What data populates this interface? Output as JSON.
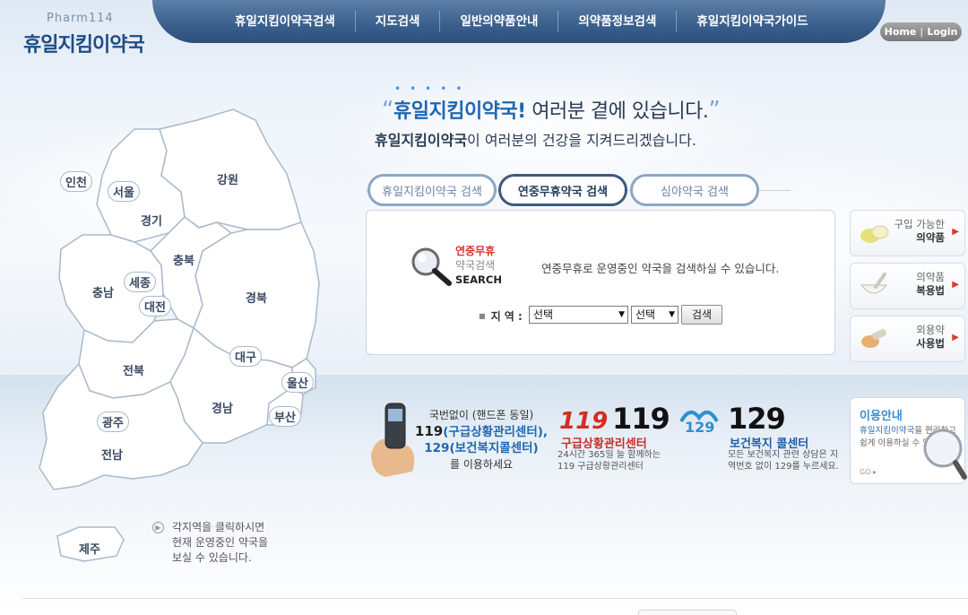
{
  "header": {
    "logo_en": "Pharm114",
    "logo_ko": "휴일지킴이약국",
    "nav": [
      {
        "label": "휴일지킴이약국검색"
      },
      {
        "label": "지도검색"
      },
      {
        "label": "일반의약품안내"
      },
      {
        "label": "의약품정보검색"
      },
      {
        "label": "휴일지킴이약국가이드"
      }
    ],
    "home_label": "Home",
    "login_label": "Login"
  },
  "map": {
    "regions": {
      "incheon": "인천",
      "seoul": "서울",
      "gyeonggi": "경기",
      "gangwon": "강원",
      "chungbuk": "충북",
      "chungnam": "충남",
      "sejong": "세종",
      "daejeon": "대전",
      "gyeongbuk": "경북",
      "daegu": "대구",
      "jeonbuk": "전북",
      "ulsan": "울산",
      "gyeongnam": "경남",
      "busan": "부산",
      "gwangju": "광주",
      "jeonnam": "전남",
      "jeju": "제주"
    },
    "note": "각지역을 클릭하시면\n현재 운영중인 약국을\n보실 수 있습니다."
  },
  "hero": {
    "brand": "휴일지킴이약국",
    "exclaim": "!",
    "line1_rest": " 여러분 곁에 있습니다.",
    "line2_brand": "휴일지킴이약국",
    "line2_rest": "이 여러분의 건강을 지켜드리겠습니다."
  },
  "search": {
    "tabs": [
      {
        "label": "휴일지킴이약국 검색",
        "active": false
      },
      {
        "label": "연중무휴약국 검색",
        "active": true
      },
      {
        "label": "심야약국 검색",
        "active": false
      }
    ],
    "label_line1": "연중무휴",
    "label_line2": "약국검색",
    "label_line3": "SEARCH",
    "description": "연중무휴로 운영중인 약국을 검색하실 수 있습니다.",
    "region_label": "지 역 :",
    "select1_value": "선택",
    "select2_value": "선택",
    "button_label": "검색"
  },
  "side_banners": [
    {
      "line1": "구입 가능한",
      "line2": "의약품",
      "icon": "pills-icon"
    },
    {
      "line1": "의약품",
      "line2": "복용법",
      "icon": "mortar-icon"
    },
    {
      "line1": "외용약",
      "line2": "사용법",
      "icon": "ointment-icon"
    }
  ],
  "info": {
    "phone_line1": "국번없이 (핸드폰 동일)",
    "phone_line2_num": "119",
    "phone_line2_rest": "(구급상황관리센터),",
    "phone_line3": "129(보건복지콜센터)",
    "phone_line4": "를 이용하세요",
    "num119": "119",
    "title119": "구급상황관리센터",
    "desc119": "24시간 365일 늘 함께하는 119 구급상황관리센터",
    "num129": "129",
    "title129": "보건복지 콜센터",
    "desc129": "모든 보건복지 관련 상담은 지역번호 없이 129를 누르세요.",
    "usage_title": "이용안내",
    "usage_hl": "휴일지킴이약국",
    "usage_text": "을 편리하고 쉽게 이용하실 수 있는 방법",
    "usage_go": "GO ▸"
  },
  "colors": {
    "nav_bg": "#3a5f8c",
    "brand_blue": "#1f67b2",
    "accent_red": "#d8322c",
    "map_stroke": "#a9b9cb"
  }
}
